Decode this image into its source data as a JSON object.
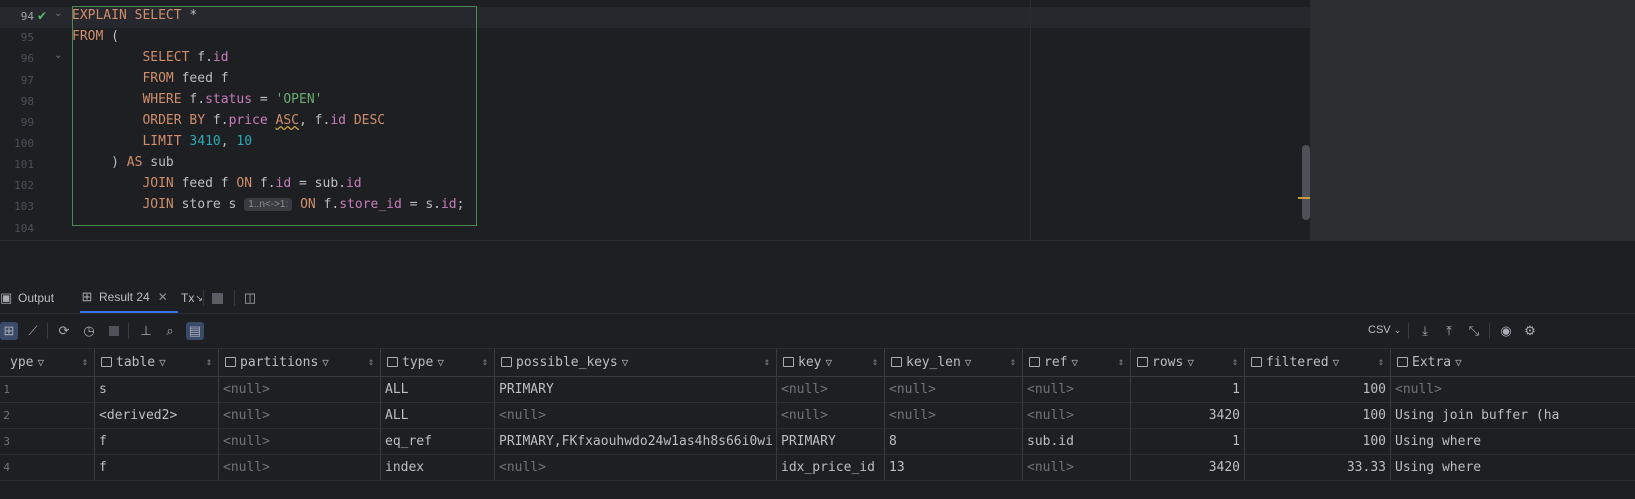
{
  "editor": {
    "lines": [
      {
        "num": "94",
        "current": true
      },
      {
        "num": "95"
      },
      {
        "num": "96"
      },
      {
        "num": "97"
      },
      {
        "num": "98"
      },
      {
        "num": "99"
      },
      {
        "num": "100"
      },
      {
        "num": "101"
      },
      {
        "num": "102"
      },
      {
        "num": "103"
      },
      {
        "num": "104"
      }
    ],
    "code": {
      "l94": {
        "k1": "EXPLAIN SELECT",
        "star": "*"
      },
      "l95": {
        "k1": "FROM",
        "p": "("
      },
      "l96": {
        "k1": "SELECT",
        "a": "f.",
        "b": "id"
      },
      "l97": {
        "k1": "FROM",
        "p": "feed f"
      },
      "l98": {
        "k1": "WHERE",
        "a": "f.",
        "b": "status",
        "eq": "=",
        "s": "'OPEN'"
      },
      "l99": {
        "k1": "ORDER BY",
        "a": "f.",
        "b": "price",
        "asc": "ASC",
        "c": ",",
        "d": "f.",
        "e": "id",
        "desc": "DESC"
      },
      "l100": {
        "k1": "LIMIT",
        "n1": "3410",
        "c": ",",
        "n2": "10"
      },
      "l101": {
        "p": ")",
        "k1": "AS",
        "q": "sub"
      },
      "l102": {
        "k1": "JOIN",
        "p": "feed f",
        "k2": "ON",
        "a": "f.",
        "b": "id",
        "eq": "= sub.",
        "c": "id"
      },
      "l103": {
        "k1": "JOIN",
        "p": "store s",
        "hint": "1..n<->1:",
        "k2": "ON",
        "a": "f.",
        "b": "store_id",
        "eq": "= s.",
        "c": "id",
        "end": ";"
      }
    }
  },
  "tabs": {
    "output": "Output",
    "result": "Result 24",
    "tx": "Tx"
  },
  "toolbar": {
    "csv": "CSV"
  },
  "table": {
    "headers": [
      "ype",
      "table",
      "partitions",
      "type",
      "possible_keys",
      "key",
      "key_len",
      "ref",
      "rows",
      "filtered",
      "Extra"
    ],
    "rows": [
      {
        "n": "1",
        "c": [
          "",
          "s",
          "<null>",
          "ALL",
          "PRIMARY",
          "<null>",
          "<null>",
          "<null>",
          "1",
          "100",
          "<null>"
        ]
      },
      {
        "n": "2",
        "c": [
          "",
          "<derived2>",
          "<null>",
          "ALL",
          "<null>",
          "<null>",
          "<null>",
          "<null>",
          "3420",
          "100",
          "Using join buffer (ha"
        ]
      },
      {
        "n": "3",
        "c": [
          "",
          "f",
          "<null>",
          "eq_ref",
          "PRIMARY,FKfxaouhwdo24w1as4h8s66i0wi",
          "PRIMARY",
          "8",
          "sub.id",
          "1",
          "100",
          "Using where"
        ]
      },
      {
        "n": "4",
        "c": [
          "",
          "f",
          "<null>",
          "index",
          "<null>",
          "idx_price_id",
          "13",
          "<null>",
          "3420",
          "33.33",
          "Using where"
        ]
      }
    ]
  }
}
